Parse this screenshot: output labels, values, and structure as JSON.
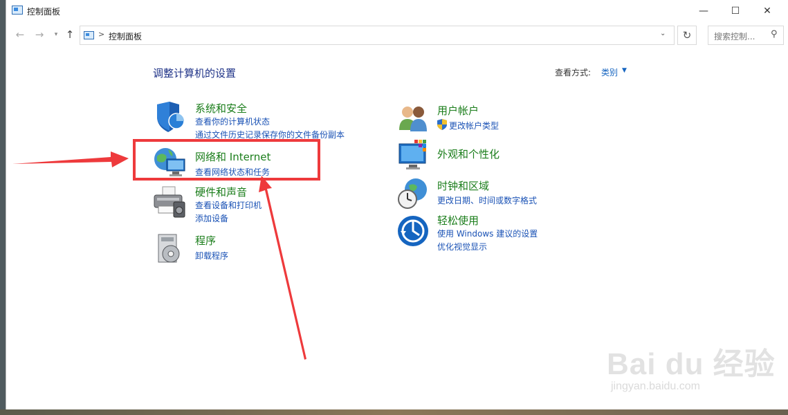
{
  "window": {
    "title": "控制面板",
    "controls": {
      "minimize": "—",
      "maximize": "☐",
      "close": "✕"
    }
  },
  "address": {
    "path": "控制面板",
    "separator": ">",
    "search_placeholder": "搜索控制..."
  },
  "page": {
    "heading": "调整计算机的设置",
    "view_by_label": "查看方式:",
    "view_by_value": "类别"
  },
  "categories_left": [
    {
      "title": "系统和安全",
      "icon": "shield-icon",
      "links": [
        "查看你的计算机状态",
        "通过文件历史记录保存你的文件备份副本"
      ]
    },
    {
      "title": "网络和 Internet",
      "icon": "network-globe-icon",
      "links": [
        "查看网络状态和任务"
      ]
    },
    {
      "title": "硬件和声音",
      "icon": "printer-icon",
      "links": [
        "查看设备和打印机",
        "添加设备"
      ]
    },
    {
      "title": "程序",
      "icon": "programs-disc-icon",
      "links": [
        "卸载程序"
      ]
    }
  ],
  "categories_right": [
    {
      "title": "用户帐户",
      "icon": "users-icon",
      "links": [
        "更改帐户类型"
      ]
    },
    {
      "title": "外观和个性化",
      "icon": "monitor-palette-icon",
      "links": []
    },
    {
      "title": "时钟和区域",
      "icon": "clock-globe-icon",
      "links": [
        "更改日期、时间或数字格式"
      ]
    },
    {
      "title": "轻松使用",
      "icon": "accessibility-icon",
      "links": [
        "使用 Windows 建议的设置",
        "优化视觉显示"
      ]
    }
  ],
  "colors": {
    "category_title": "#1a7d1a",
    "link": "#1a52b5",
    "heading": "#1e3287",
    "annotation_red": "#ee3a3c"
  },
  "watermark": {
    "main": "Bai du 经验",
    "sub": "jingyan.baidu.com"
  }
}
